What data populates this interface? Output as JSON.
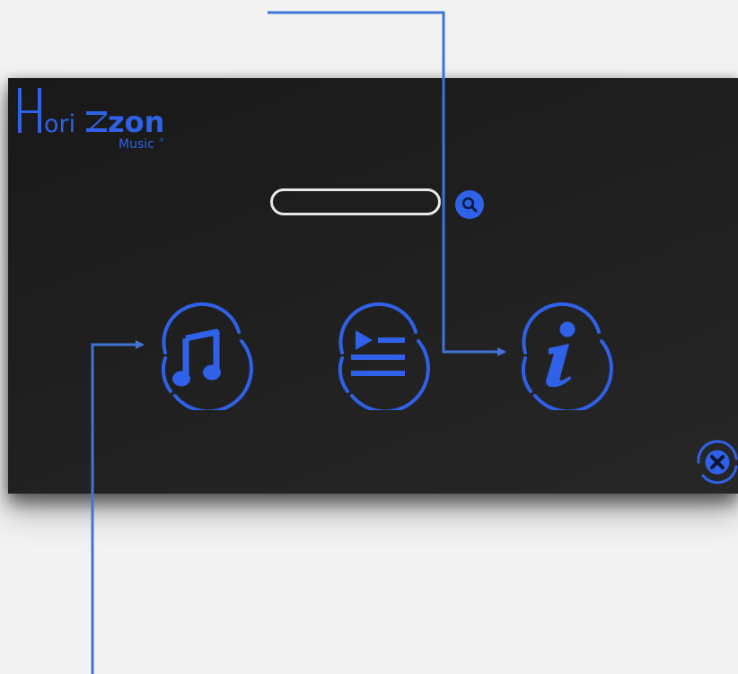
{
  "app": {
    "logo": {
      "wordmark_left": "ori",
      "wordmark_right": "zon",
      "initial": "H",
      "subtitle": "Music",
      "trademark": "®"
    },
    "search": {
      "placeholder": "",
      "value": "",
      "button_icon": "search-icon"
    },
    "nav_buttons": [
      {
        "name": "music",
        "icon": "music-note-icon"
      },
      {
        "name": "playlist",
        "icon": "playlist-icon"
      },
      {
        "name": "info",
        "icon": "info-icon"
      }
    ],
    "close_icon": "close-icon"
  },
  "colors": {
    "accent": "#2f62e8",
    "callout": "#3f74d6",
    "window_bg": "#1e1e1e",
    "page_bg": "#f2f2f3",
    "search_border": "#e8e8e8"
  }
}
